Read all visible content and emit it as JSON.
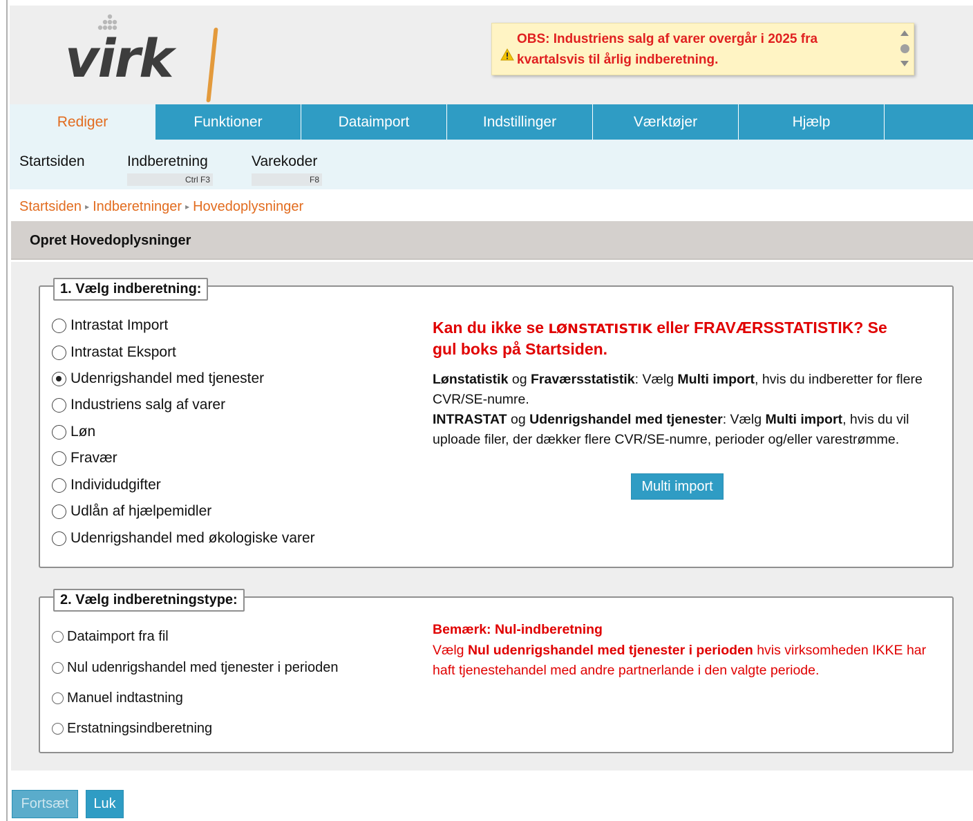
{
  "logo": {
    "text": "virk"
  },
  "notice": {
    "text": "OBS: Industriens salg af varer overgår i 2025 fra kvartalsvis til årlig indberetning.",
    "icon": "warning-icon"
  },
  "nav": {
    "tabs": [
      {
        "label": "Rediger",
        "active": true
      },
      {
        "label": "Funktioner"
      },
      {
        "label": "Dataimport"
      },
      {
        "label": "Indstillinger"
      },
      {
        "label": "Værktøjer"
      },
      {
        "label": "Hjælp"
      }
    ]
  },
  "subnav": {
    "items": [
      {
        "label": "Startsiden"
      },
      {
        "label": "Indberetning",
        "shortcut": "Ctrl F3"
      },
      {
        "label": "Varekoder",
        "shortcut": "F8"
      }
    ]
  },
  "breadcrumb": [
    "Startsiden",
    "Indberetninger",
    "Hovedoplysninger"
  ],
  "section": {
    "title": "Opret Hovedoplysninger"
  },
  "step1": {
    "legend": "1. Vælg indberetning:",
    "options": [
      "Intrastat Import",
      "Intrastat Eksport",
      "Udenrigshandel med tjenester",
      "Industriens salg af varer",
      "Løn",
      "Fravær",
      "Individudgifter",
      "Udlån af hjælpemidler",
      "Udenrigshandel med økologiske varer"
    ],
    "selected": "Udenrigshandel med tjenester",
    "info": {
      "title_part1": "Kan du ikke se ",
      "title_bold1": "LØNSTATISTIK",
      "title_part2": " eller ",
      "title_bold2": "FRAVÆRSSTATISTIK",
      "title_part3": "? Se gul boks på Startsiden.",
      "p1_b1": "Lønstatistik",
      "p1_t1": " og ",
      "p1_b2": "Fraværsstatistik",
      "p1_t2": ": Vælg ",
      "p1_b3": "Multi import",
      "p1_t3": ", hvis du indberetter for flere CVR/SE-numre.",
      "p2_b1": "INTRASTAT",
      "p2_t1": " og ",
      "p2_b2": "Udenrigshandel med tjenester",
      "p2_t2": ": Vælg ",
      "p2_b3": "Multi import",
      "p2_t3": ", hvis du vil uploade filer, der dækker flere CVR/SE-numre, perioder og/eller varestrømme."
    },
    "multi_import_label": "Multi import"
  },
  "step2": {
    "legend": "2. Vælg indberetningstype:",
    "options": [
      "Dataimport fra fil",
      "Nul udenrigshandel med tjenester i perioden",
      "Manuel indtastning",
      "Erstatningsindberetning"
    ],
    "note": {
      "title": "Bemærk: Nul-indberetning",
      "t1": "Vælg ",
      "b1": "Nul udenrigshandel med tjenester i perioden",
      "t2": " hvis virksomheden IKKE har haft tjenestehandel med andre partnerlande i den valgte periode."
    }
  },
  "buttons": {
    "continue": "Fortsæt",
    "close": "Luk"
  },
  "colors": {
    "brand_blue": "#2f9cc4",
    "accent_orange": "#e26c1f",
    "alert_red": "#e00000",
    "notice_bg": "#fff4c4"
  }
}
